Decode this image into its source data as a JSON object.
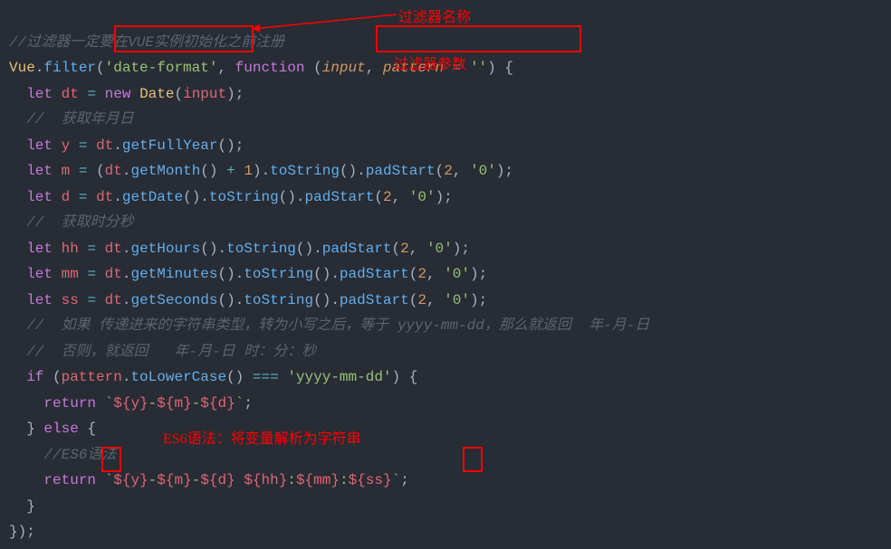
{
  "annotations": {
    "top_comment_label": "过滤器名称",
    "param_label": "过滤器参数",
    "es6_label": "ES6语法：将变量解析为字符串"
  },
  "code": {
    "l1_cmt": "//过滤器一定要在VUE实例初始化之前注册",
    "l2_vue": "Vue",
    "l2_filter": "filter",
    "l2_str": "'date-format'",
    "l2_func": "function",
    "l2_input": "input",
    "l2_pattern": "pattern",
    "l2_eq": "=",
    "l2_empty": "''",
    "l3_let": "let",
    "l3_dt": "dt",
    "l3_new": "new",
    "l3_date": "Date",
    "l3_arg": "input",
    "l4_cmt": "//  获取年月日",
    "l5_y": "y",
    "l5_gfy": "getFullYear",
    "l6_m": "m",
    "l6_gm": "getMonth",
    "l6_one": "1",
    "l6_ts": "toString",
    "l6_ps": "padStart",
    "l6_two": "2",
    "l6_zero": "'0'",
    "l7_d": "d",
    "l7_gd": "getDate",
    "l8_cmt": "//  获取时分秒",
    "l9_hh": "hh",
    "l9_gh": "getHours",
    "l10_mm": "mm",
    "l10_gmin": "getMinutes",
    "l11_ss": "ss",
    "l11_gs": "getSeconds",
    "l12_cmt": "//  如果 传递进来的字符串类型，转为小写之后，等于 yyyy-mm-dd，那么就返回  年-月-日",
    "l13_cmt": "//  否则，就返回   年-月-日 时：分：秒",
    "l14_if": "if",
    "l14_tolc": "toLowerCase",
    "l14_eqop": "===",
    "l14_str": "'yyyy-mm-dd'",
    "l15_ret": "return",
    "l15_tpl1": "`",
    "l15_y": "y",
    "l15_m": "m",
    "l15_d": "d",
    "l16_else": "else",
    "l17_cmt": "//ES6语法",
    "l18_ret": "return",
    "l18_hh": "hh",
    "l18_mm": "mm",
    "l18_ss": "ss"
  }
}
